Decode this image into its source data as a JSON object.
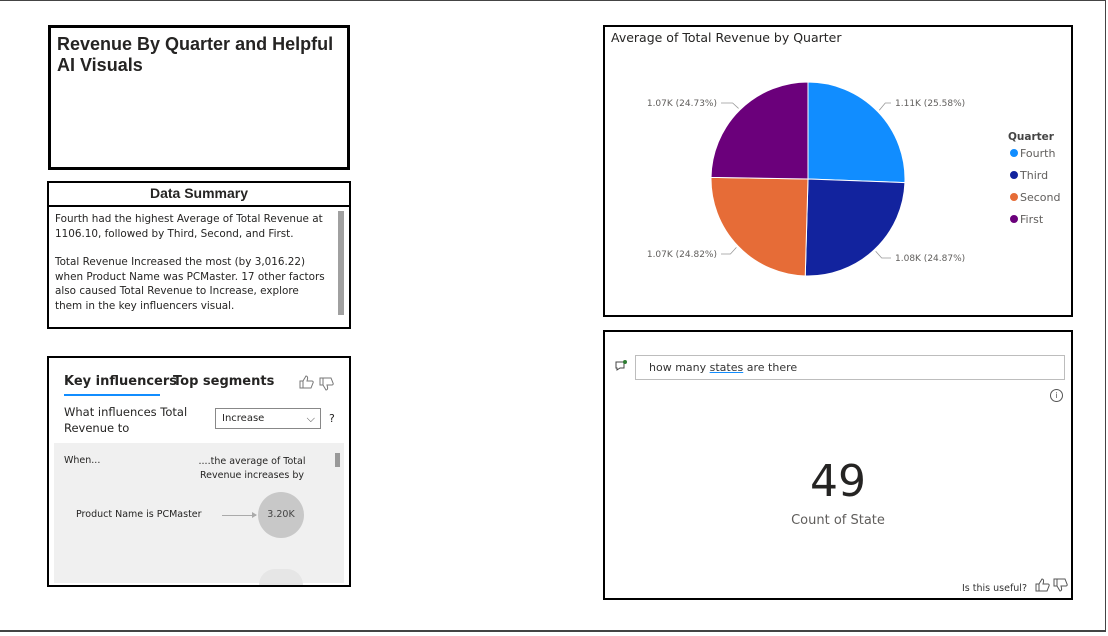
{
  "title_card": {
    "title": "Revenue By Quarter and Helpful AI Visuals"
  },
  "summary": {
    "header": "Data Summary",
    "paragraph1": "Fourth had the highest Average of Total Revenue at 1106.10, followed by Third, Second, and First.",
    "paragraph2": "Total Revenue Increased the most (by 3,016.22) when Product Name was PCMaster. 17 other factors also caused Total Revenue to Increase, explore them in the key influencers visual."
  },
  "key_influencers": {
    "tab_key": "Key influencers",
    "tab_top": "Top segments",
    "question": "What influences Total Revenue to",
    "select_value": "Increase",
    "help": "?",
    "when_label": "When...",
    "avg_label": "....the average of Total Revenue increases by",
    "factor": "Product Name is PCMaster",
    "factor_value": "3.20K",
    "icons": {
      "like": "thumbs-up-icon",
      "dislike": "thumbs-down-icon"
    }
  },
  "pie": {
    "title": "Average of Total Revenue by Quarter",
    "legend_title": "Quarter"
  },
  "chart_data": {
    "type": "pie",
    "title": "Average of Total Revenue by Quarter",
    "legend_title": "Quarter",
    "legend_position": "right",
    "slices": [
      {
        "name": "Fourth",
        "value": 1106.1,
        "percent": 25.58,
        "label": "1.11K (25.58%)",
        "color": "#118dff"
      },
      {
        "name": "Third",
        "value": 1075.0,
        "percent": 24.87,
        "label": "1.08K (24.87%)",
        "color": "#12239e"
      },
      {
        "name": "Second",
        "value": 1073.0,
        "percent": 24.82,
        "label": "1.07K (24.82%)",
        "color": "#e66c37"
      },
      {
        "name": "First",
        "value": 1069.0,
        "percent": 24.73,
        "label": "1.07K (24.73%)",
        "color": "#6b007b"
      }
    ]
  },
  "qa": {
    "query_prefix": "how many ",
    "query_underlined": "states",
    "query_suffix": " are there",
    "value": "49",
    "label": "Count of State",
    "useful": "Is this useful?",
    "info": "i"
  }
}
